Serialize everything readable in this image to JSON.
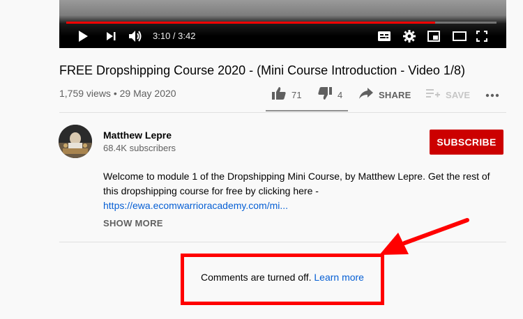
{
  "player": {
    "time": "3:10 / 3:42",
    "progress_fraction": 0.857
  },
  "video": {
    "title": "FREE Dropshipping Course 2020 - (Mini Course Introduction - Video 1/8)",
    "views": "1,759 views",
    "date": "29 May 2020"
  },
  "actions": {
    "likes": "71",
    "dislikes": "4",
    "share": "SHARE",
    "save": "SAVE"
  },
  "channel": {
    "name": "Matthew Lepre",
    "subscribers": "68.4K subscribers",
    "subscribe_label": "SUBSCRIBE"
  },
  "description": {
    "line1": "Welcome to module 1 of the Dropshipping Mini Course, by Matthew Lepre. Get the rest of",
    "line2": "this dropshipping course for free by clicking here -",
    "link": "https://ewa.ecomwarrioracademy.com/mi...",
    "show_more": "SHOW MORE"
  },
  "comments": {
    "message": "Comments are turned off.",
    "learn_more": "Learn more"
  },
  "colors": {
    "accent_red": "#ff0000",
    "subscribe_red": "#cc0000",
    "link_blue": "#065fd4"
  },
  "icons": [
    "play-icon",
    "next-icon",
    "volume-icon",
    "subtitles-icon",
    "settings-icon",
    "miniplayer-icon",
    "theater-icon",
    "fullscreen-icon",
    "like-icon",
    "dislike-icon",
    "share-icon",
    "save-icon",
    "more-icon"
  ]
}
